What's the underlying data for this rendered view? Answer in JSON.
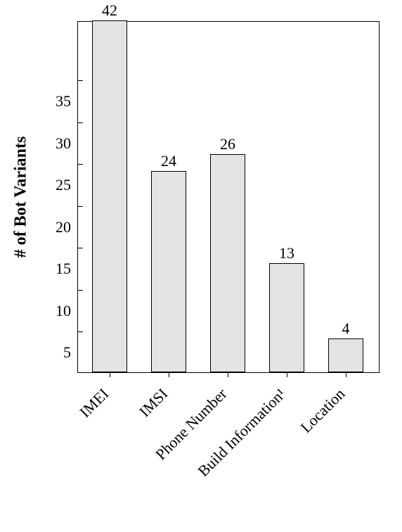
{
  "chart_data": {
    "type": "bar",
    "categories": [
      "IMEI",
      "IMSI",
      "Phone Number",
      "Build Information¹",
      "Location"
    ],
    "values": [
      42,
      24,
      26,
      13,
      4
    ],
    "title": "",
    "xlabel": "",
    "ylabel": "# of Bot Variants",
    "ylim": [
      0,
      42
    ],
    "yticks": [
      5,
      10,
      15,
      20,
      25,
      30,
      35
    ],
    "bar_fill": "#e3e3e3",
    "bar_stroke": "#000000"
  }
}
